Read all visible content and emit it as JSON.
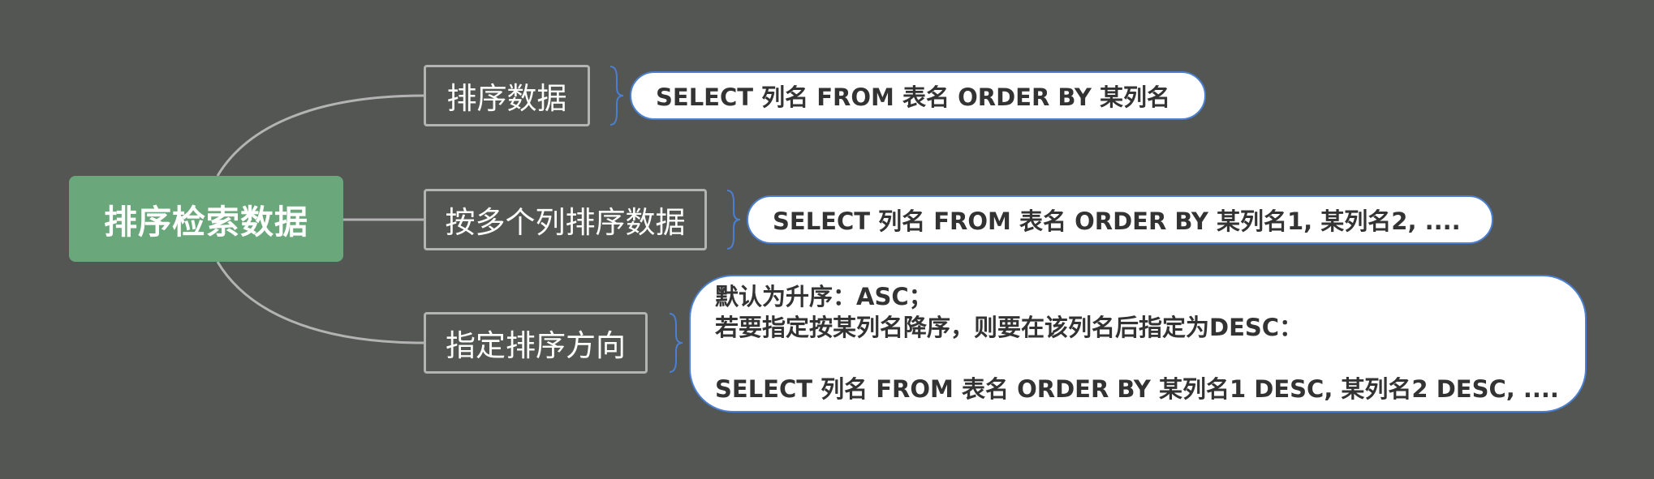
{
  "root": {
    "label": "排序检索数据"
  },
  "branches": [
    {
      "label": "排序数据",
      "notes": [
        "SELECT 列名 FROM 表名 ORDER BY 某列名"
      ]
    },
    {
      "label": "按多个列排序数据",
      "notes": [
        "SELECT 列名 FROM 表名 ORDER BY 某列名1, 某列名2, ...."
      ]
    },
    {
      "label": "指定排序方向",
      "notes": [
        "默认为升序：ASC；",
        "若要指定按某列名降序，则要在该列名后指定为DESC：",
        "",
        "SELECT 列名 FROM 表名 ORDER BY 某列名1 DESC, 某列名2 DESC, ...."
      ]
    }
  ],
  "colors": {
    "background": "#545654",
    "root_fill": "#6aa87b",
    "connector": "#b3b3b3",
    "brace": "#4a7fd1",
    "leaf_border": "#4a7fd1",
    "leaf_text": "#333333"
  }
}
